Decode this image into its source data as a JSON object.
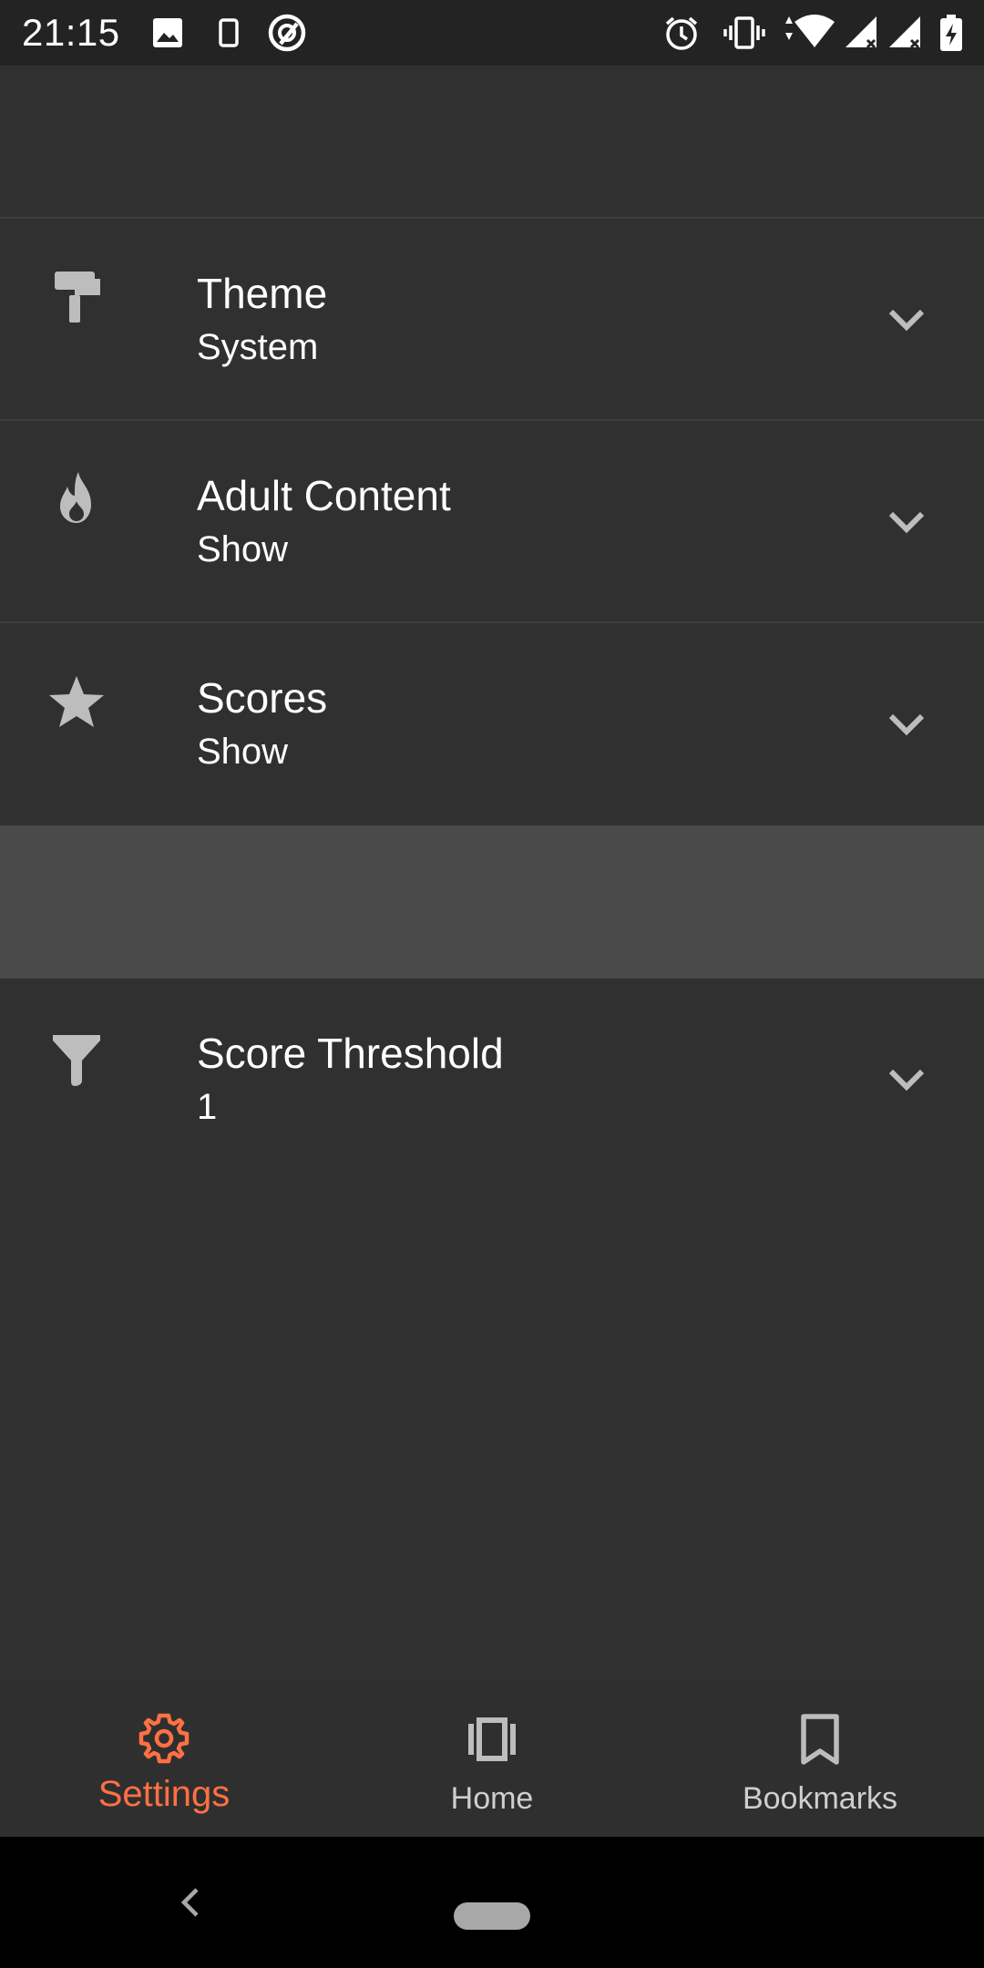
{
  "status_bar": {
    "time": "21:15",
    "left_icons": [
      "image-icon",
      "phone-icon",
      "no-disturb-icon"
    ],
    "right_icons": [
      "alarm-icon",
      "vibrate-icon",
      "wifi-icon",
      "cell-signal-icon",
      "cell-signal-icon",
      "battery-charging-icon"
    ]
  },
  "settings": {
    "rows": [
      {
        "icon": "paint-roller-icon",
        "title": "Theme",
        "value": "System"
      },
      {
        "icon": "flame-icon",
        "title": "Adult Content",
        "value": "Show"
      },
      {
        "icon": "star-icon",
        "title": "Scores",
        "value": "Show"
      },
      {
        "icon": "filter-icon",
        "title": "Score Threshold",
        "value": "1"
      }
    ]
  },
  "bottom_nav": {
    "items": [
      {
        "label": "Settings",
        "icon": "gear-icon",
        "active": true
      },
      {
        "label": "Home",
        "icon": "carousel-icon",
        "active": false
      },
      {
        "label": "Bookmarks",
        "icon": "bookmark-icon",
        "active": false
      }
    ]
  },
  "colors": {
    "background": "#303030",
    "status_bar": "#232323",
    "section_divider": "#4a4a4a",
    "accent": "#ff7043",
    "icon_gray": "#bdbdbd",
    "text": "#ffffff",
    "inactive_label": "#cfcfcf"
  }
}
